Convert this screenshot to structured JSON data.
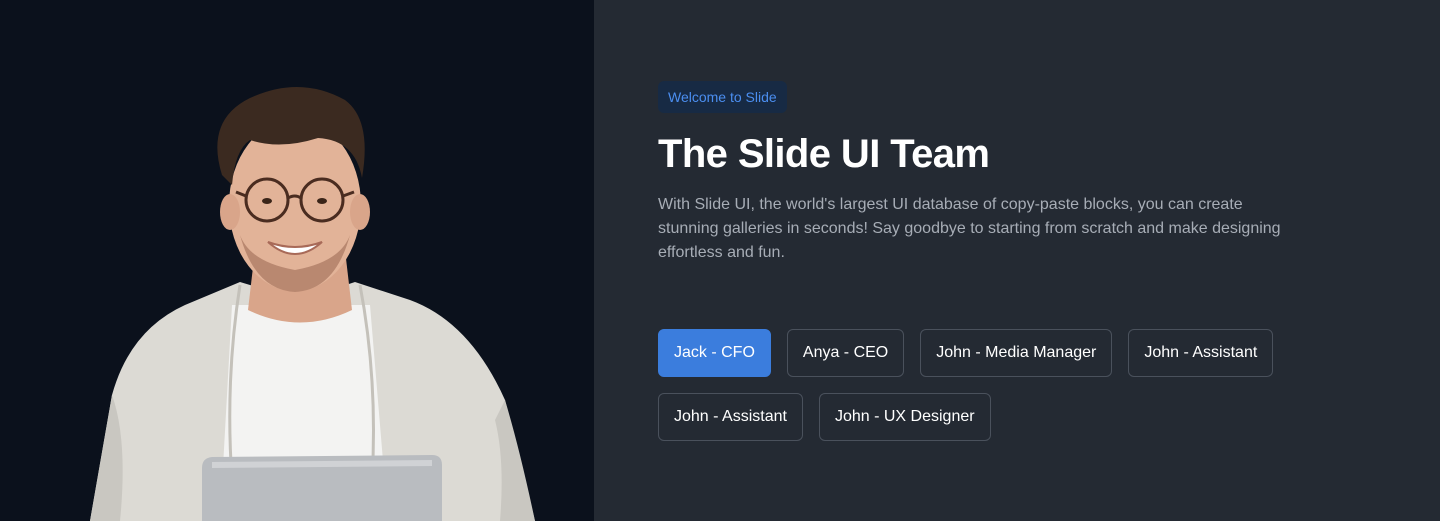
{
  "hero": {
    "badge": "Welcome to Slide",
    "title": "The Slide UI Team",
    "description": "With Slide UI, the world's largest UI database of copy-paste blocks, you can create stunning galleries in seconds! Say goodbye to starting from scratch and make designing effortless and fun."
  },
  "members": [
    {
      "label": "Jack - CFO",
      "active": true
    },
    {
      "label": "Anya - CEO",
      "active": false
    },
    {
      "label": "John - Media Manager",
      "active": false
    },
    {
      "label": "John - Assistant",
      "active": false
    },
    {
      "label": "John - Assistant",
      "active": false
    },
    {
      "label": "John - UX Designer",
      "active": false
    }
  ],
  "colors": {
    "left_bg": "#0b111c",
    "right_bg": "#242a33",
    "accent": "#3b7ddd",
    "badge_bg": "#172a44",
    "badge_text": "#4b8ef0"
  }
}
